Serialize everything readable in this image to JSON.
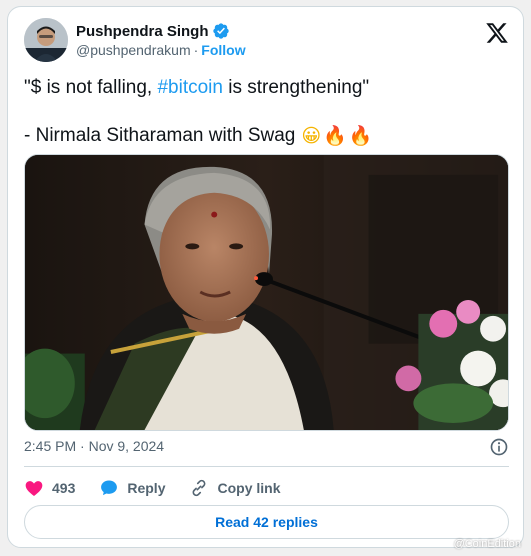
{
  "author": {
    "display_name": "Pushpendra Singh",
    "handle": "@pushpendrakum",
    "separator": "·",
    "follow_label": "Follow",
    "verified": true
  },
  "tweet": {
    "line1_prefix": "\"$ is not falling, ",
    "hashtag": "#bitcoin",
    "line1_suffix": " is strengthening\"",
    "line2": "- Nirmala Sitharaman with Swag",
    "emojis": [
      "😀",
      "🔥",
      "🔥"
    ]
  },
  "media": {
    "alt_description_icon": "photo"
  },
  "meta": {
    "timestamp": "2:45 PM · Nov 9, 2024"
  },
  "actions": {
    "like_count": "493",
    "reply_label": "Reply",
    "copy_label": "Copy link"
  },
  "footer": {
    "read_replies_label": "Read 42 replies"
  },
  "watermark": "@CoinEdition",
  "colors": {
    "accent": "#1d9bf0",
    "like": "#f91880",
    "text_secondary": "#536471",
    "border": "#cfd9de"
  }
}
